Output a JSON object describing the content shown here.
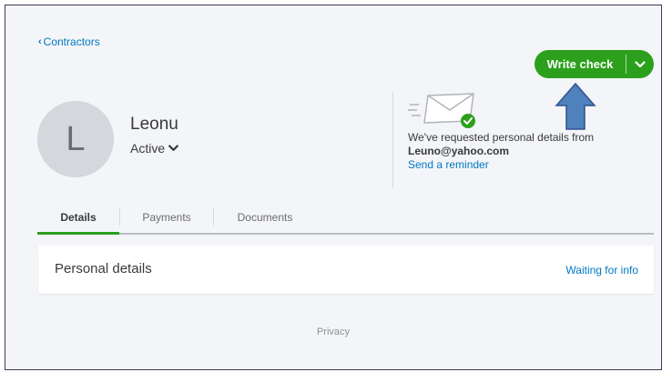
{
  "breadcrumb": {
    "label": "Contractors"
  },
  "actions": {
    "write_check_label": "Write check"
  },
  "contractor": {
    "initial": "L",
    "name": "Leonu",
    "status": "Active"
  },
  "request": {
    "message": "We've requested personal details from",
    "email": "Leuno@yahoo.com",
    "reminder_link": "Send a reminder"
  },
  "tabs": [
    {
      "label": "Details",
      "active": true
    },
    {
      "label": "Payments",
      "active": false
    },
    {
      "label": "Documents",
      "active": false
    }
  ],
  "personal_details": {
    "title": "Personal details",
    "status_link": "Waiting for info"
  },
  "footer": {
    "privacy_link": "Privacy"
  },
  "colors": {
    "accent_green": "#2ca01c",
    "link_blue": "#0077c5",
    "annotation_arrow": "#4f81bd"
  }
}
